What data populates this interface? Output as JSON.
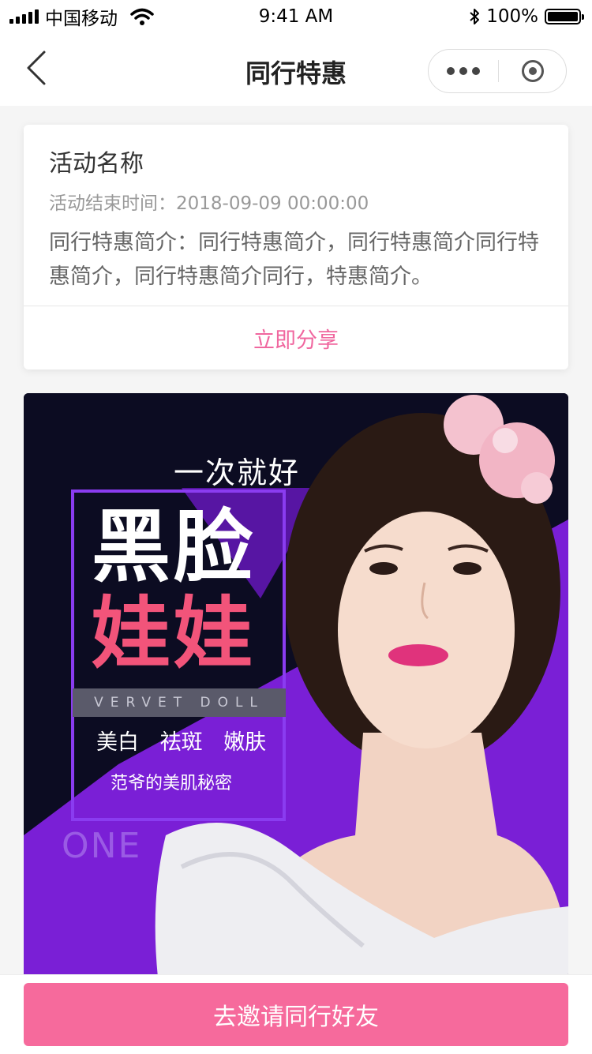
{
  "status_bar": {
    "carrier": "中国移动",
    "time": "9:41 AM",
    "battery": "100%"
  },
  "nav": {
    "title": "同行特惠"
  },
  "activity": {
    "name": "活动名称",
    "end_time_label": "活动结束时间：",
    "end_time": "2018-09-09 00:00:00",
    "intro": "同行特惠简介：同行特惠简介，同行特惠简介同行特惠简介，同行特惠简介同行，特惠简介。",
    "share_label": "立即分享"
  },
  "poster": {
    "slogan": "一次就好",
    "title_line1": "黑脸",
    "title_line2": "娃娃",
    "english": "VERVET DOLL",
    "tags": "美白 祛斑 嫩肤",
    "subtitle": "范爷的美肌秘密",
    "brand": "ONE"
  },
  "bottom": {
    "invite_label": "去邀请同行好友"
  },
  "colors": {
    "accent_pink": "#f66a9c",
    "share_text": "#f0679f",
    "poster_dark": "#0c0c22",
    "poster_purple": "#7a1fd6",
    "title_pink": "#f2547a"
  }
}
